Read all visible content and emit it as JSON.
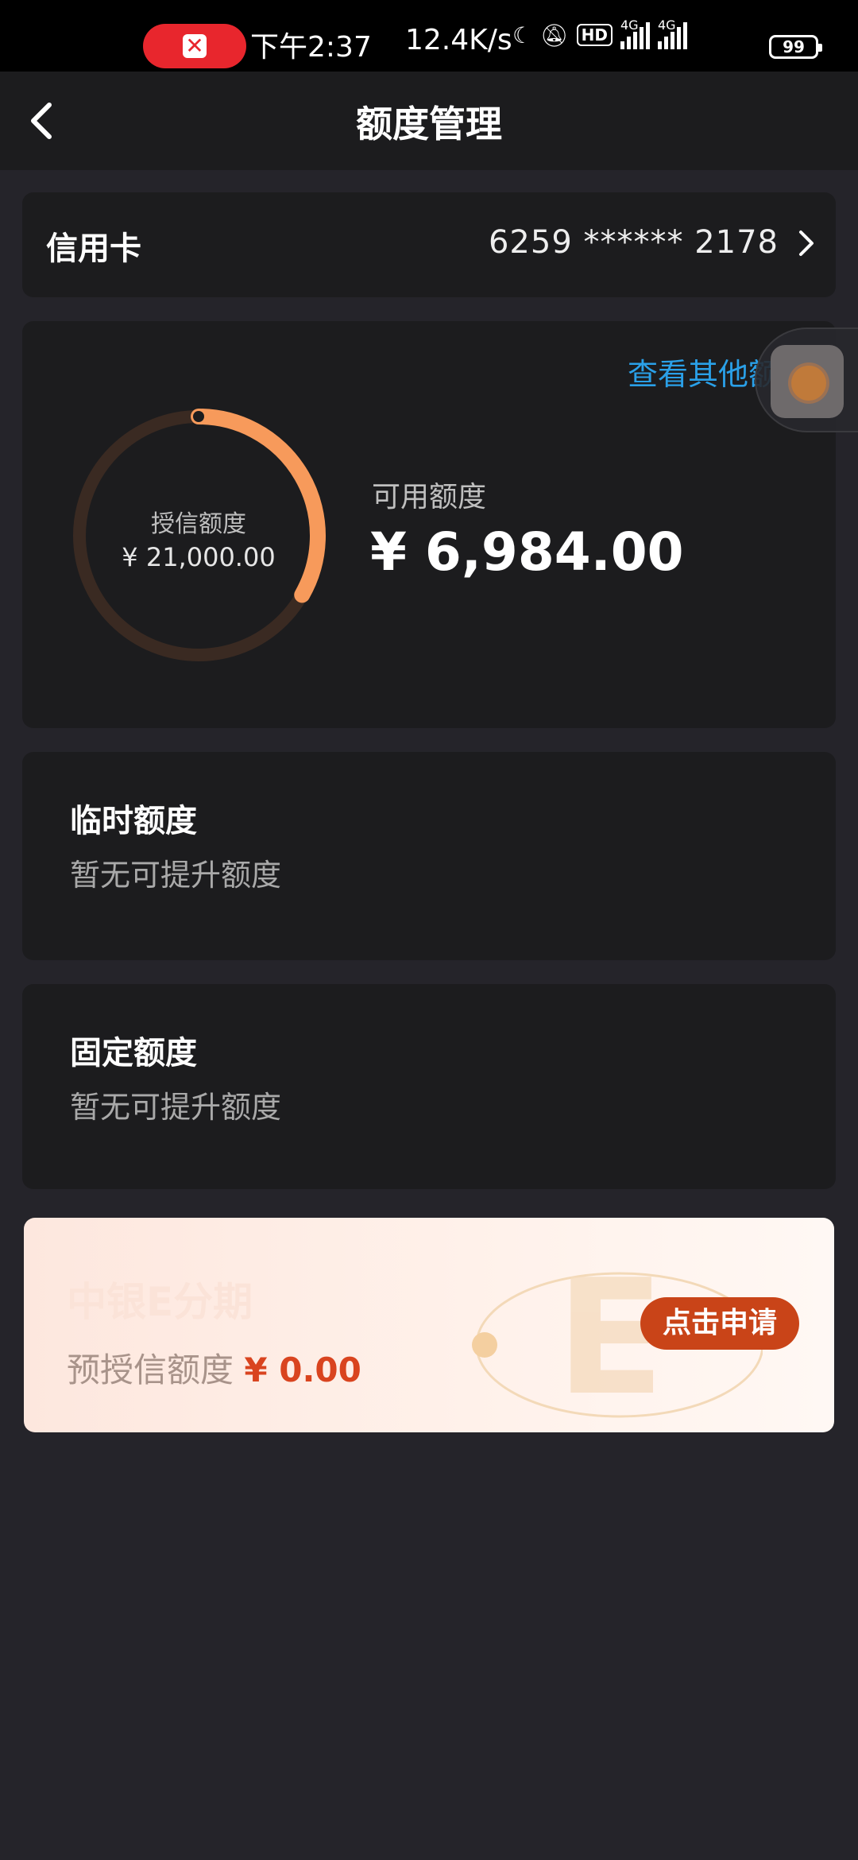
{
  "status_bar": {
    "time": "下午2:37",
    "net_speed": "12.4K/s",
    "hd_label": "HD",
    "signal_1_label": "4G",
    "signal_2_label": "4G",
    "battery": "99"
  },
  "header": {
    "title": "额度管理"
  },
  "credit_card": {
    "label": "信用卡",
    "number_masked": "6259 ****** 2178"
  },
  "credit_summary": {
    "other_limits_link": "查看其他额度",
    "total_label": "授信额度",
    "total_amount": "¥ 21,000.00",
    "available_label": "可用额度",
    "available_amount": "¥ 6,984.00",
    "ring_fraction_available": 0.3326
  },
  "temp_limit": {
    "title": "临时额度",
    "status": "暂无可提升额度"
  },
  "fixed_limit": {
    "title": "固定额度",
    "status": "暂无可提升额度"
  },
  "promo": {
    "title": "中银E分期",
    "pre_credit_label": "预授信额度",
    "pre_credit_amount": "¥ 0.00",
    "apply_button": "点击申请"
  },
  "colors": {
    "accent_orange": "#f79a5b",
    "link_blue": "#2aa0e8",
    "promo_red": "#d9441f"
  }
}
